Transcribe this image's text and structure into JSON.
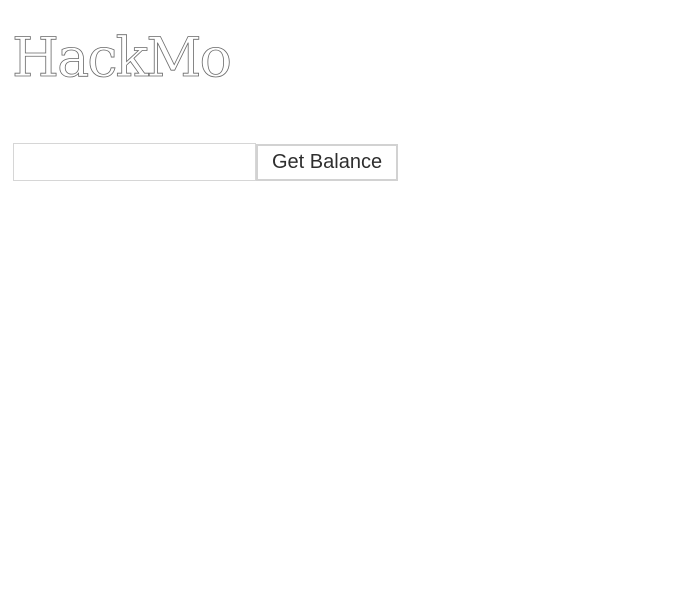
{
  "header": {
    "brand_title": "HackMo"
  },
  "balance_form": {
    "address_input": {
      "value": "",
      "placeholder": ""
    },
    "get_balance_label": "Get Balance"
  }
}
